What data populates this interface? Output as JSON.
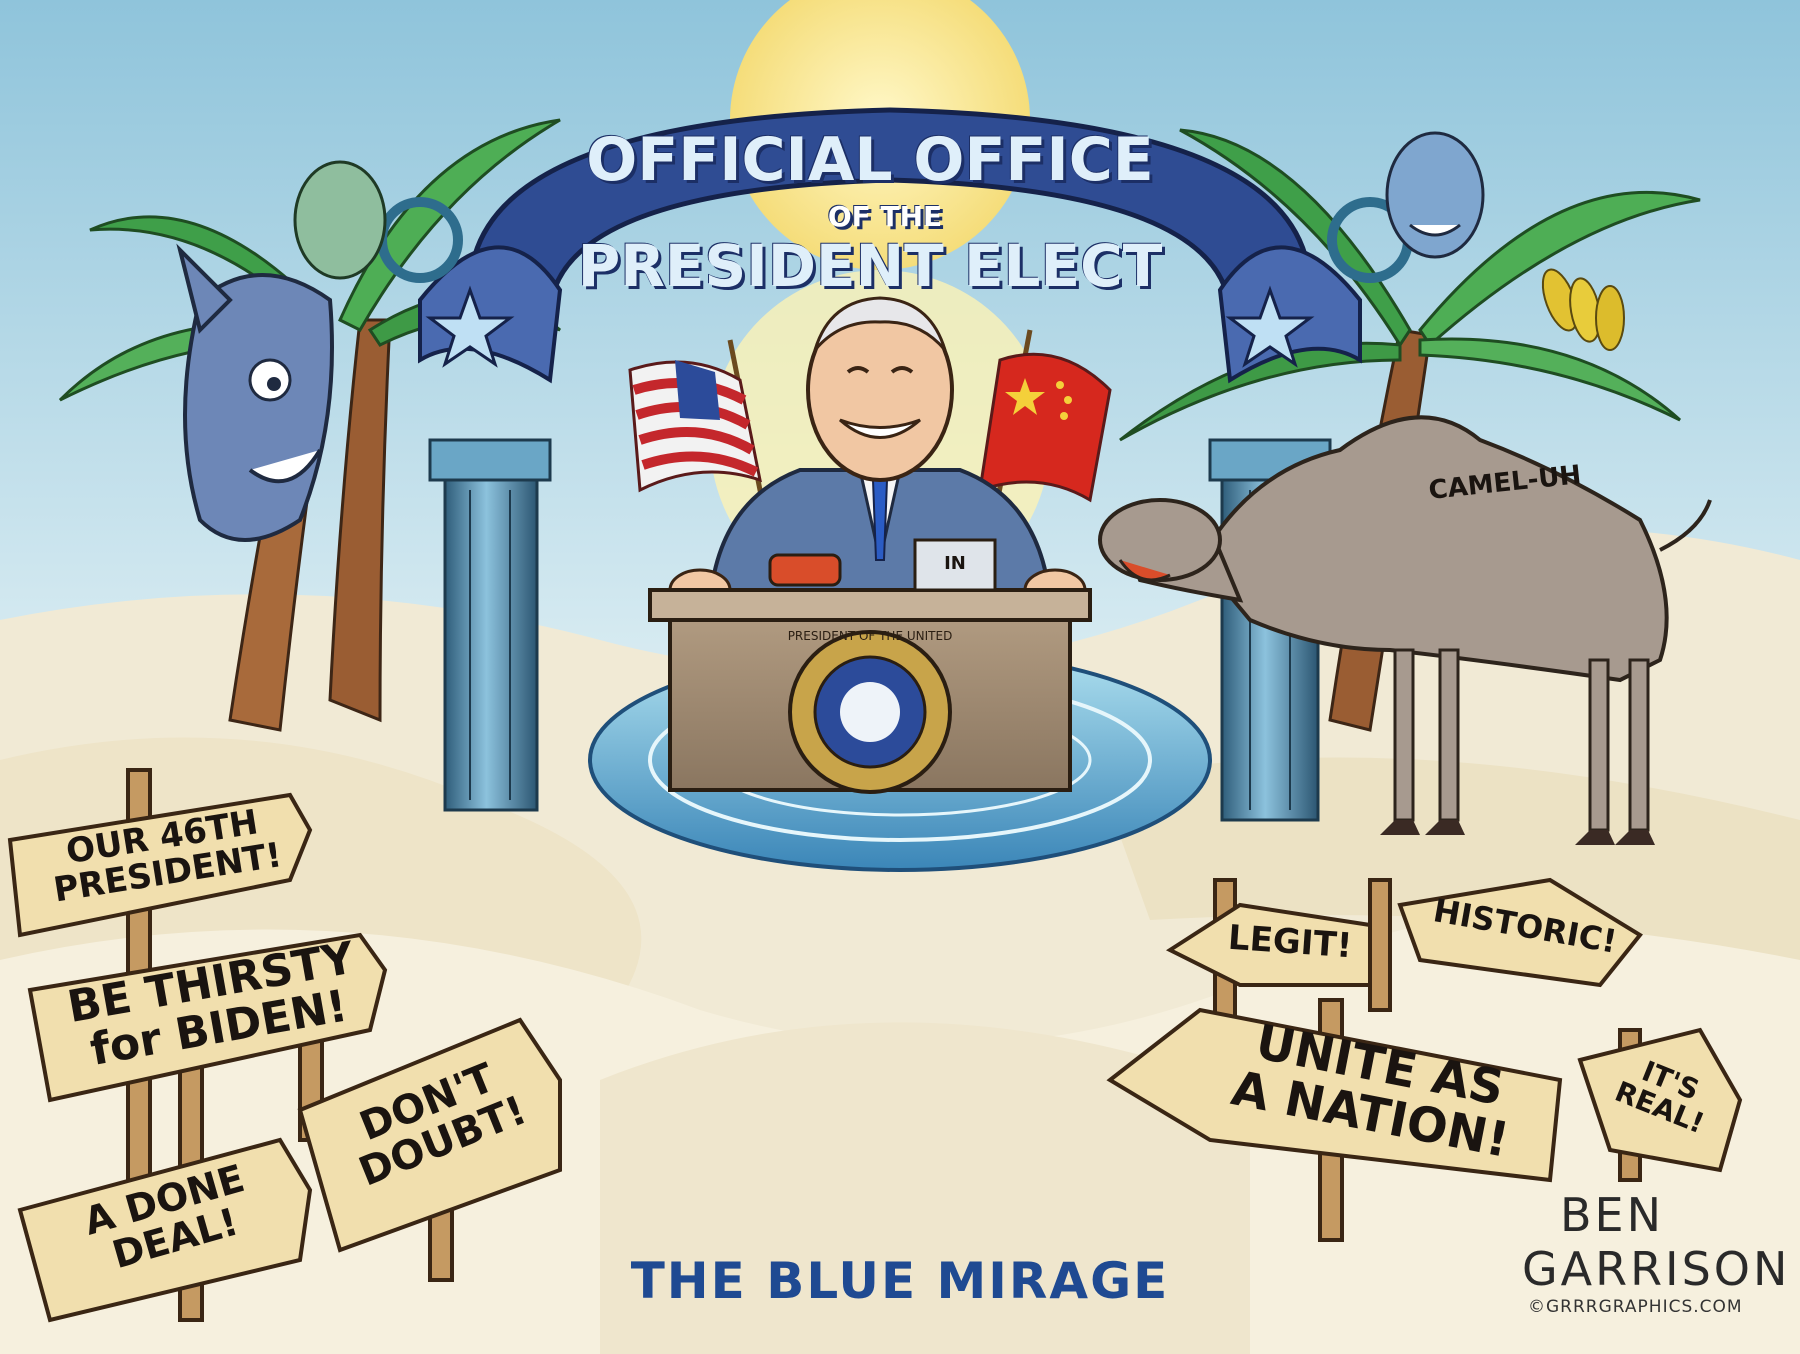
{
  "banner": {
    "line1": "OFFICIAL OFFICE",
    "line2": "OF THE",
    "line3": "PRESIDENT ELECT"
  },
  "desk": {
    "seal_text": "PRESIDENT OF THE UNITED",
    "inbox_label": "IN"
  },
  "camel_label": "CAMEL-UH",
  "signs_left": [
    {
      "line1": "OUR 46TH",
      "line2": "PRESIDENT!"
    },
    {
      "line1": "BE THIRSTY",
      "line2": "for BIDEN!"
    },
    {
      "line1": "A DONE",
      "line2": "DEAL!"
    },
    {
      "line1": "DON'T",
      "line2": "DOUBT!"
    }
  ],
  "signs_right": [
    {
      "line1": "LEGIT!"
    },
    {
      "line1": "HISTORIC!"
    },
    {
      "line1": "UNITE AS",
      "line2": "A NATION!"
    },
    {
      "line1": "IT'S",
      "line2": "REAL!"
    }
  ],
  "caption": "THE BLUE MIRAGE",
  "signature": {
    "line1": "BEN",
    "line2": "GARRISON",
    "line3": "©GRRRGRAPHICS.COM"
  }
}
